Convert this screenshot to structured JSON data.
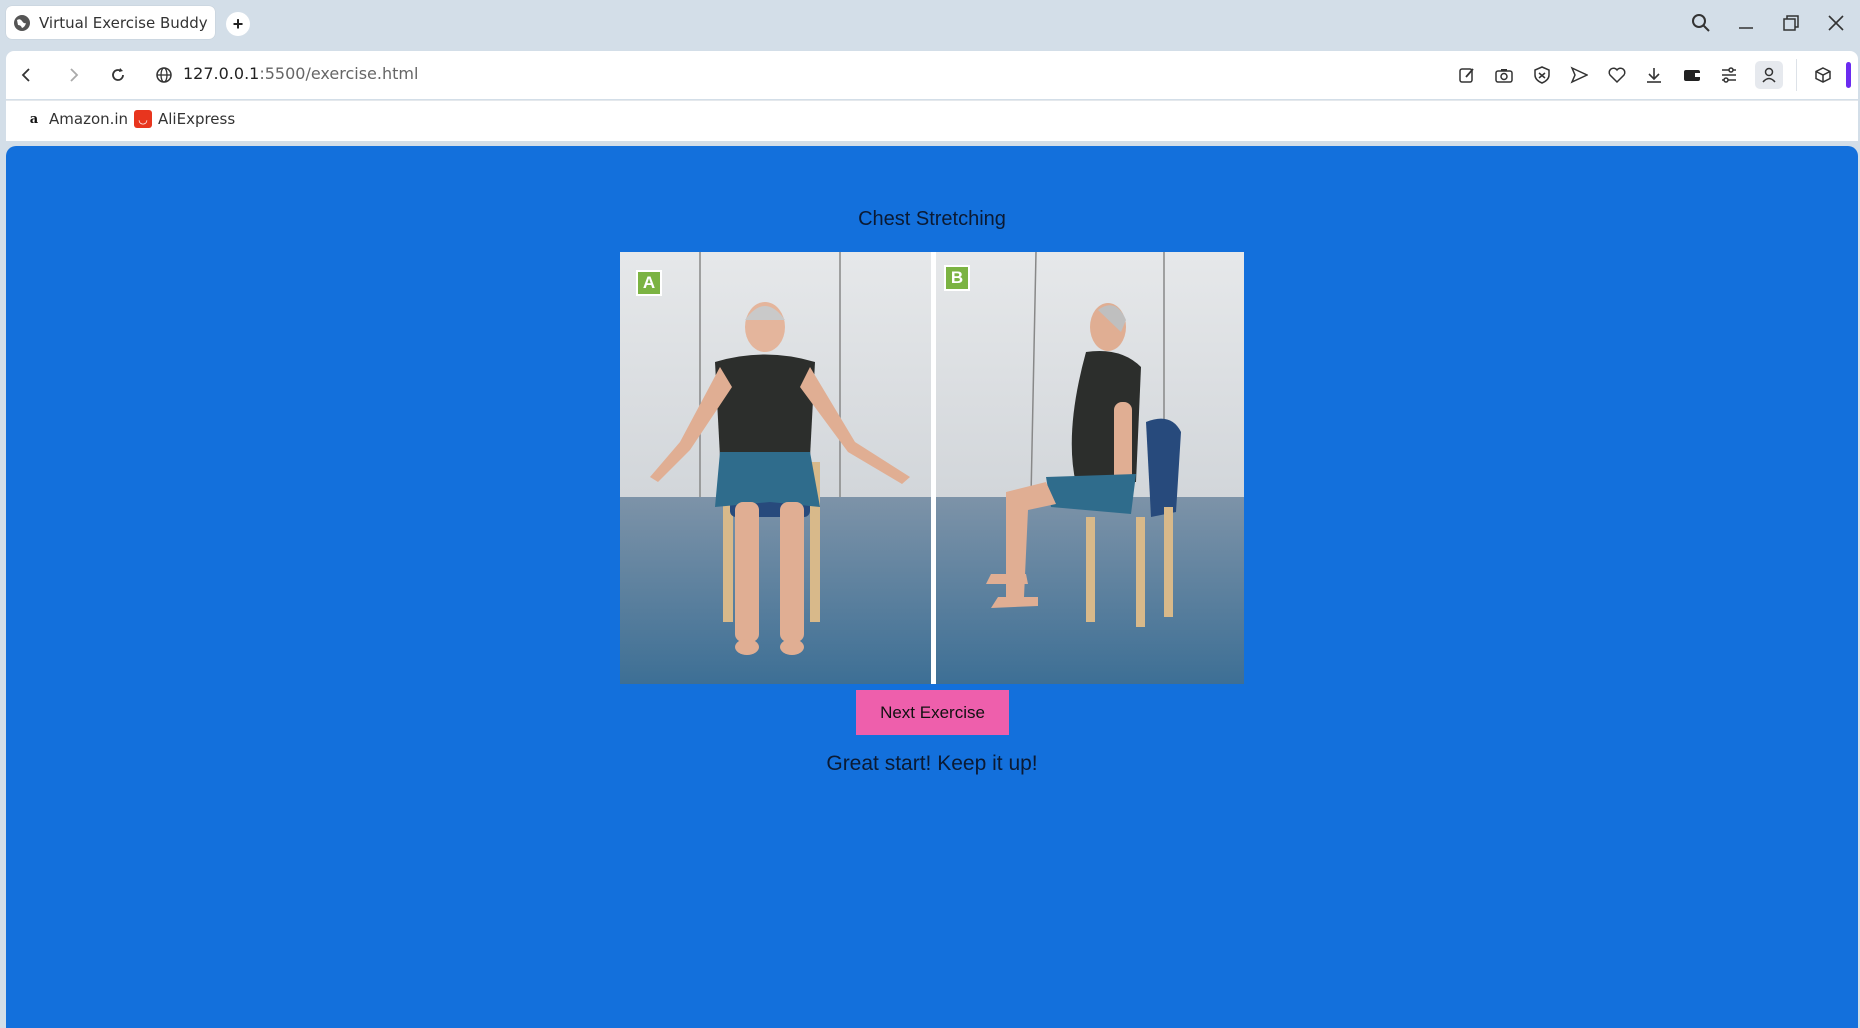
{
  "browser": {
    "tab_title": "Virtual Exercise Buddy",
    "new_tab_label": "+",
    "url_host": "127.0.0.1",
    "url_path": ":5500/exercise.html",
    "bookmarks": [
      {
        "label": "Amazon.in",
        "icon": "amazon-icon"
      },
      {
        "label": "AliExpress",
        "icon": "aliexpress-icon"
      }
    ]
  },
  "page": {
    "heading": "Chest Stretching",
    "photo_labels": [
      "A",
      "B"
    ],
    "next_button": "Next Exercise",
    "message": "Great start! Keep it up!"
  },
  "colors": {
    "page_background": "#1370dc",
    "button": "#ee5fac",
    "badge": "#7bb342"
  }
}
